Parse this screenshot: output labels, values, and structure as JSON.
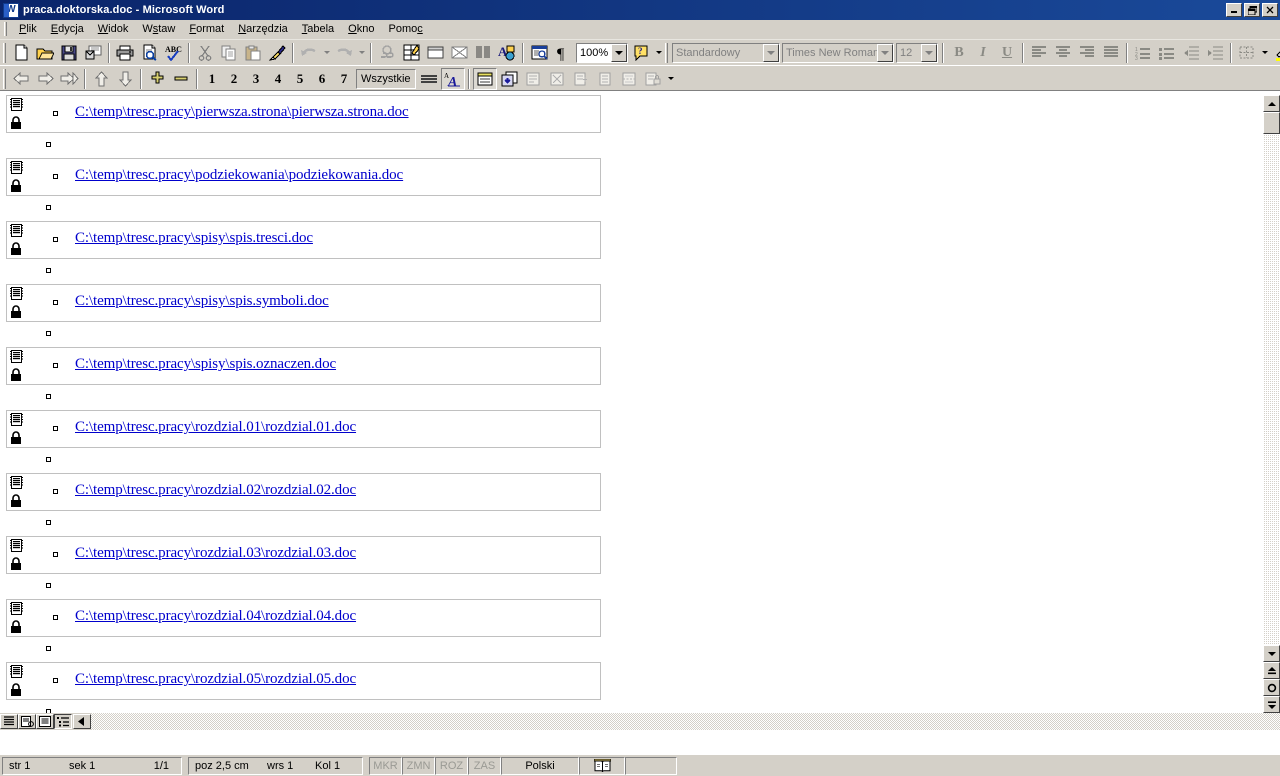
{
  "window": {
    "title": "praca.doktorska.doc - Microsoft Word",
    "app_icon": "word-document-icon",
    "minimize_label": "_",
    "restore_label": "❐",
    "close_label": "✕"
  },
  "menubar": {
    "items": [
      {
        "name": "menu-plik",
        "label": "Plik",
        "accel": "P"
      },
      {
        "name": "menu-edycja",
        "label": "Edycja",
        "accel": "E"
      },
      {
        "name": "menu-widok",
        "label": "Widok",
        "accel": "W"
      },
      {
        "name": "menu-wstaw",
        "label": "Wstaw",
        "accel": "s"
      },
      {
        "name": "menu-format",
        "label": "Format",
        "accel": "F"
      },
      {
        "name": "menu-narzedzia",
        "label": "Narzędzia",
        "accel": "N"
      },
      {
        "name": "menu-tabela",
        "label": "Tabela",
        "accel": "T"
      },
      {
        "name": "menu-okno",
        "label": "Okno",
        "accel": "O"
      },
      {
        "name": "menu-pomoc",
        "label": "Pomoć",
        "accel": "c"
      }
    ]
  },
  "toolbar_standard": {
    "buttons": [
      {
        "name": "new-document-icon",
        "title": "Nowy"
      },
      {
        "name": "open-folder-icon",
        "title": "Otwórz"
      },
      {
        "name": "save-disk-icon",
        "title": "Zapisz"
      },
      {
        "name": "email-icon",
        "title": "Poczta e-mail"
      },
      {
        "name": "print-icon",
        "title": "Drukuj"
      },
      {
        "name": "print-preview-icon",
        "title": "Podgląd wydruku"
      },
      {
        "name": "spelling-check-icon",
        "title": "Pisownia i gramatyka"
      },
      {
        "name": "cut-scissors-icon",
        "title": "Wytnij"
      },
      {
        "name": "copy-icon",
        "title": "Kopiuj"
      },
      {
        "name": "paste-icon",
        "title": "Wklej"
      },
      {
        "name": "format-painter-icon",
        "title": "Malarz formatów"
      },
      {
        "name": "undo-icon",
        "title": "Cofnij"
      },
      {
        "name": "redo-icon",
        "title": "Wykonaj ponownie"
      },
      {
        "name": "insert-hyperlink-icon",
        "title": "Wstaw hiperłącze"
      },
      {
        "name": "tables-and-borders-icon",
        "title": "Tabele i krawędzie"
      },
      {
        "name": "insert-table-icon",
        "title": "Wstaw tabelę"
      },
      {
        "name": "insert-excel-sheet-icon",
        "title": "Wstaw arkusz programu Excel"
      },
      {
        "name": "columns-icon",
        "title": "Kolumny"
      },
      {
        "name": "drawing-icon",
        "title": "Rysowanie"
      },
      {
        "name": "document-map-icon",
        "title": "Mapa dokumentu"
      },
      {
        "name": "show-formatting-marks-icon",
        "title": "Pokaż wszystko"
      },
      {
        "name": "office-assistant-icon",
        "title": "Pomoc programu Microsoft Word"
      }
    ],
    "zoom_value": "100%"
  },
  "formatting_bar": {
    "style_value": "Standardowy",
    "font_value": "Times New Roman",
    "size_value": "12",
    "bold_label": "B",
    "italic_label": "I",
    "underline_label": "U",
    "buttons": [
      {
        "name": "align-left-icon"
      },
      {
        "name": "align-center-icon"
      },
      {
        "name": "align-right-icon"
      },
      {
        "name": "align-justify-icon"
      },
      {
        "name": "numbered-list-icon"
      },
      {
        "name": "bulleted-list-icon"
      },
      {
        "name": "decrease-indent-icon"
      },
      {
        "name": "increase-indent-icon"
      },
      {
        "name": "borders-icon"
      },
      {
        "name": "highlight-color-icon"
      },
      {
        "name": "font-color-icon"
      }
    ]
  },
  "toolbar_outline": {
    "buttons": [
      {
        "name": "promote-icon",
        "title": "Podwyższ poziom"
      },
      {
        "name": "demote-icon",
        "title": "Obniż poziom"
      },
      {
        "name": "demote-to-body-icon",
        "title": "Obniż do tekstu podstawowego"
      },
      {
        "name": "move-up-icon",
        "title": "Przenieś w górę"
      },
      {
        "name": "move-down-icon",
        "title": "Przenieś w dół"
      },
      {
        "name": "expand-icon",
        "title": "Rozwiń"
      },
      {
        "name": "collapse-icon",
        "title": "Zwiń"
      }
    ],
    "level_labels": [
      "1",
      "2",
      "3",
      "4",
      "5",
      "6",
      "7"
    ],
    "show_all_label": "Wszystkie",
    "first_line_only_icon": "show-first-line-only-icon",
    "show_formatting_icon": "show-formatting-icon",
    "master_buttons": [
      {
        "name": "master-document-view-icon",
        "title": "Widok dokumentu głównego",
        "pressed": true
      },
      {
        "name": "expand-subdocuments-icon",
        "title": "Zwiń dokumenty podrzędne"
      },
      {
        "name": "create-subdocument-icon",
        "title": "Utwórz dokument podrzędny"
      },
      {
        "name": "remove-subdocument-icon",
        "title": "Usuń dokument podrzędny"
      },
      {
        "name": "insert-subdocument-icon",
        "title": "Wstaw dokument podrzędny"
      },
      {
        "name": "merge-subdocument-icon",
        "title": "Scal dokument podrzędny"
      },
      {
        "name": "split-subdocument-icon",
        "title": "Podziel dokument podrzędny"
      },
      {
        "name": "lock-document-icon",
        "title": "Zablokuj dokument"
      }
    ]
  },
  "document": {
    "subdocuments": [
      {
        "name": "subdocument-link",
        "path": "C:\\temp\\tresc.pracy\\pierwsza.strona\\pierwsza.strona.doc",
        "locked": true
      },
      {
        "name": "subdocument-link",
        "path": "C:\\temp\\tresc.pracy\\podziekowania\\podziekowania.doc",
        "locked": true
      },
      {
        "name": "subdocument-link",
        "path": "C:\\temp\\tresc.pracy\\spisy\\spis.tresci.doc",
        "locked": true
      },
      {
        "name": "subdocument-link",
        "path": "C:\\temp\\tresc.pracy\\spisy\\spis.symboli.doc",
        "locked": true
      },
      {
        "name": "subdocument-link",
        "path": "C:\\temp\\tresc.pracy\\spisy\\spis.oznaczen.doc",
        "locked": true
      },
      {
        "name": "subdocument-link",
        "path": "C:\\temp\\tresc.pracy\\rozdzial.01\\rozdzial.01.doc",
        "locked": true
      },
      {
        "name": "subdocument-link",
        "path": "C:\\temp\\tresc.pracy\\rozdzial.02\\rozdzial.02.doc",
        "locked": true
      },
      {
        "name": "subdocument-link",
        "path": "C:\\temp\\tresc.pracy\\rozdzial.03\\rozdzial.03.doc",
        "locked": true
      },
      {
        "name": "subdocument-link",
        "path": "C:\\temp\\tresc.pracy\\rozdzial.04\\rozdzial.04.doc",
        "locked": true
      },
      {
        "name": "subdocument-link",
        "path": "C:\\temp\\tresc.pracy\\rozdzial.05\\rozdzial.05.doc",
        "locked": true
      }
    ],
    "link_color": "#0000cc",
    "subdoc_border_color": "#c0c0c0"
  },
  "view_bar": {
    "buttons": [
      {
        "name": "normal-view-button",
        "icon": "normal-view-icon",
        "active": false
      },
      {
        "name": "web-layout-view-button",
        "icon": "web-layout-icon",
        "active": false
      },
      {
        "name": "print-layout-view-button",
        "icon": "print-layout-icon",
        "active": false
      },
      {
        "name": "outline-view-button",
        "icon": "outline-view-icon",
        "active": true
      }
    ],
    "scroll_left_label": "◄"
  },
  "statusbar": {
    "page_label": "str  1",
    "section_label": "sek  1",
    "page_of_label": "1/1",
    "position_label": "poz  2,5 cm",
    "line_label": "wrs  1",
    "column_label": "Kol  1",
    "indicators": [
      "MKR",
      "ZMN",
      "ROZ",
      "ZAS"
    ],
    "language": "Polski",
    "spellcheck_icon": "spellcheck-book-icon"
  },
  "colors": {
    "titlebar_start": "#0a246a",
    "titlebar_end": "#1a4a9a",
    "chrome": "#d4d0c8",
    "link": "#0000cc",
    "disabled_text": "#808080"
  }
}
